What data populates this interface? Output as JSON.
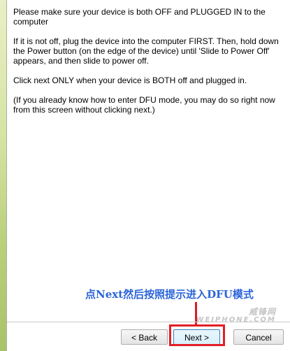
{
  "instructions": {
    "para1": "Please make sure your device is both OFF and PLUGGED IN to the computer",
    "para2": "If it is not off, plug the device into the computer FIRST. Then, hold down the Power button (on the edge of the device) until 'Slide to Power Off' appears, and then slide to power off.",
    "para3": "Click next ONLY when your device is BOTH off and plugged in.",
    "para4": "(If you already know how to enter DFU mode, you may do so right now from this screen without clicking next.)"
  },
  "annotation": {
    "caption": "点Next然后按照提示进入DFU模式",
    "watermark_main": "威锋网",
    "watermark_sub": "WEIPHONE.COM"
  },
  "buttons": {
    "back_label": "< Back",
    "next_label": "Next >",
    "cancel_label": "Cancel"
  },
  "colors": {
    "caption": "#2b65d9",
    "highlight": "#e21e26"
  }
}
